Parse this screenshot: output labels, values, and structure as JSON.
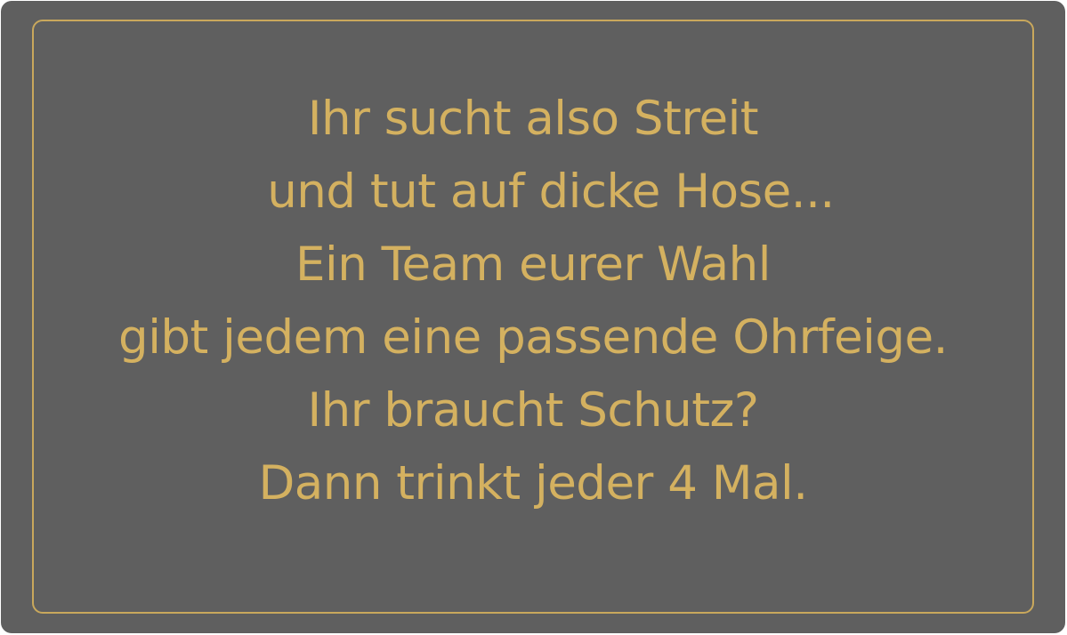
{
  "card": {
    "colors": {
      "background": "#5f5f5f",
      "border": "#c9a85c",
      "text": "#d4b160"
    },
    "lines": [
      "Ihr sucht also Streit",
      "und tut auf dicke Hose...",
      "Ein Team eurer Wahl",
      "gibt jedem eine passende Ohrfeige.",
      "Ihr braucht Schutz?",
      "Dann trinkt jeder 4 Mal."
    ]
  }
}
